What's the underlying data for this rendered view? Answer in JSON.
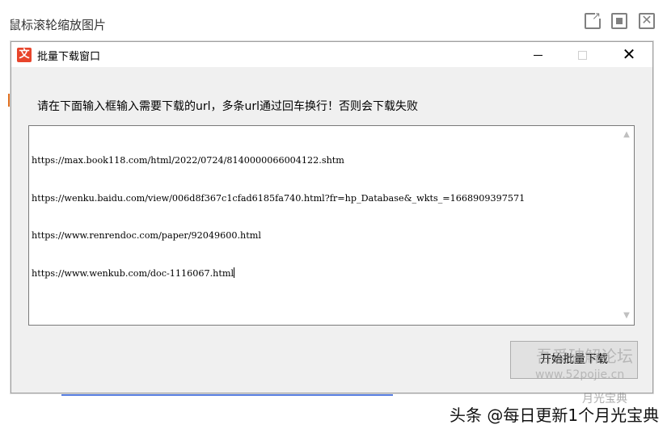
{
  "outer": {
    "title": "鼠标滚轮缩放图片",
    "icons": [
      "external-link-icon",
      "maximize-icon",
      "close-icon"
    ]
  },
  "dialog": {
    "title": "批量下载窗口",
    "app_icon_glyph": "文",
    "app_icon_color": "#e8452c",
    "controls": {
      "minimize": "—",
      "maximize": "☐",
      "close": "✕"
    },
    "instruction": "请在下面输入框输入需要下载的url，多条url通过回车换行！否则会下载失败",
    "urls": [
      "https://max.book118.com/html/2022/0724/8140000066004122.shtm",
      "https://wenku.baidu.com/view/006d8f367c1cfad6185fa740.html?fr=hp_Database&_wkts_=1668909397571",
      "https://www.renrendoc.com/paper/92049600.html",
      "https://www.wenkub.com/doc-1116067.html"
    ],
    "start_button_label": "开始批量下载"
  },
  "watermarks": {
    "forum": "吾爱破解论坛",
    "forum_url": "www.52pojie.cn",
    "source": "头条 @每日更新1个月光宝典",
    "source_small": "月光宝典"
  }
}
